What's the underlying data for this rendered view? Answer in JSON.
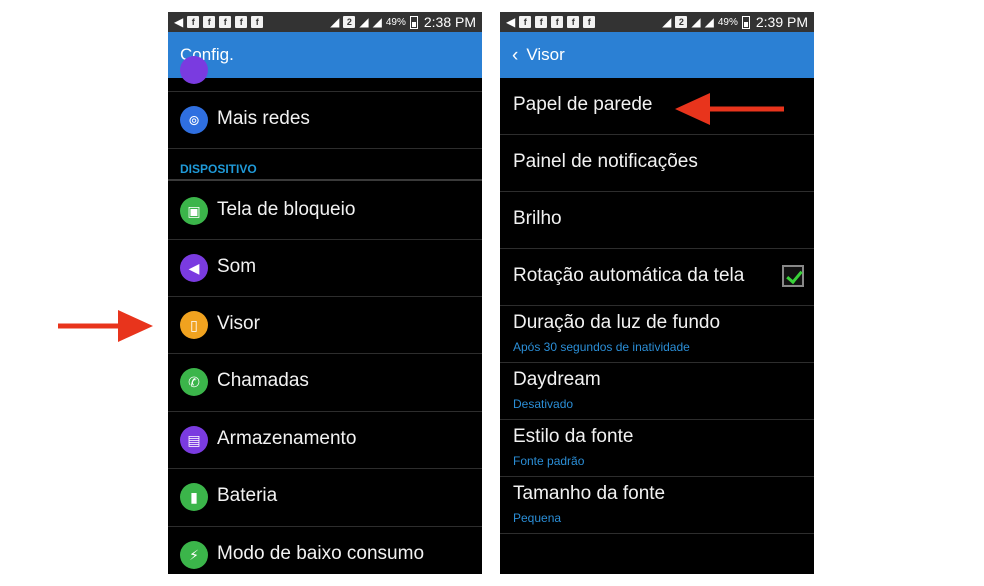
{
  "left_phone": {
    "status": {
      "notif_letter": "f",
      "sim_badge": "2",
      "battery_percent": "49%",
      "time": "2:38 PM"
    },
    "title": "Config.",
    "items_top": [
      {
        "label": "Mais redes",
        "icon": "network-icon",
        "color": "#2f6fe0"
      }
    ],
    "section_header": "DISPOSITIVO",
    "items": [
      {
        "label": "Tela de bloqueio",
        "icon": "lock-screen-icon",
        "color": "#3bb54a"
      },
      {
        "label": "Som",
        "icon": "speaker-icon",
        "color": "#7a3be0"
      },
      {
        "label": "Visor",
        "icon": "display-icon",
        "color": "#f0a21f"
      },
      {
        "label": "Chamadas",
        "icon": "phone-icon",
        "color": "#3bb54a"
      },
      {
        "label": "Armazenamento",
        "icon": "storage-icon",
        "color": "#7a3be0"
      },
      {
        "label": "Bateria",
        "icon": "battery-icon",
        "color": "#3bb54a"
      },
      {
        "label": "Modo de baixo consumo",
        "icon": "power-saving-icon",
        "color": "#3bb54a"
      }
    ]
  },
  "right_phone": {
    "status": {
      "notif_letter": "f",
      "sim_badge": "2",
      "battery_percent": "49%",
      "time": "2:39 PM"
    },
    "back_glyph": "‹",
    "title": "Visor",
    "items": [
      {
        "title": "Papel de parede",
        "subtitle": ""
      },
      {
        "title": "Painel de notificações",
        "subtitle": ""
      },
      {
        "title": "Brilho",
        "subtitle": ""
      },
      {
        "title": "Rotação automática da tela",
        "subtitle": "",
        "checked": true
      },
      {
        "title": "Duração da luz de fundo",
        "subtitle": "Após 30 segundos de inatividade"
      },
      {
        "title": "Daydream",
        "subtitle": "Desativado"
      },
      {
        "title": "Estilo da fonte",
        "subtitle": "Fonte padrão"
      },
      {
        "title": "Tamanho da fonte",
        "subtitle": "Pequena"
      }
    ]
  },
  "annotation_color": "#e8341c"
}
